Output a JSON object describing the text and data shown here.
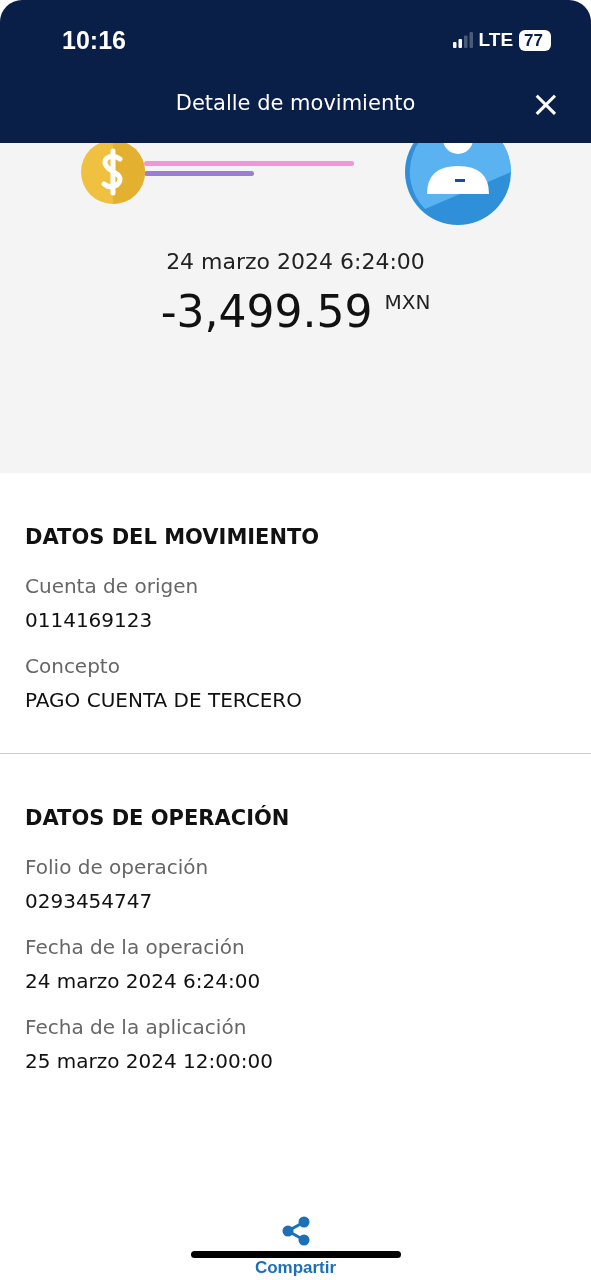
{
  "status_bar": {
    "time": "10:16",
    "network": "LTE",
    "battery": "77"
  },
  "header": {
    "title": "Detalle de movimiento",
    "close": "×"
  },
  "summary": {
    "date": "24 marzo 2024 6:24:00",
    "amount": "-3,499.59",
    "currency": "MXN"
  },
  "sections": [
    {
      "title": "DATOS DEL MOVIMIENTO",
      "fields": [
        {
          "label": "Cuenta de origen",
          "value": "0114169123"
        },
        {
          "label": "Concepto",
          "value": "PAGO CUENTA DE TERCERO"
        }
      ]
    },
    {
      "title": "DATOS DE OPERACIÓN",
      "fields": [
        {
          "label": "Folio de operación",
          "value": "0293454747"
        },
        {
          "label": "Fecha de la operación",
          "value": "24 marzo 2024 6:24:00"
        },
        {
          "label": "Fecha de la aplicación",
          "value": "25 marzo 2024 12:00:00"
        }
      ]
    }
  ],
  "share": {
    "label": "Compartir"
  }
}
